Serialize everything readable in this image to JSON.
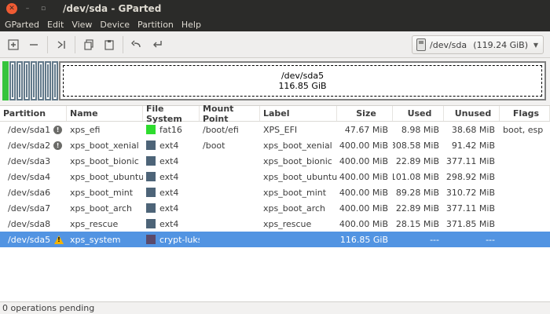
{
  "window": {
    "title": "/dev/sda - GParted",
    "close_glyph": "✕",
    "min_glyph": "–",
    "max_glyph": "▫"
  },
  "menu": [
    "GParted",
    "Edit",
    "View",
    "Device",
    "Partition",
    "Help"
  ],
  "toolbar": {
    "icons": [
      "new-icon",
      "delete-icon",
      "resize-move-icon",
      "copy-icon",
      "paste-icon",
      "undo-icon",
      "apply-icon"
    ],
    "device_label": "/dev/sda",
    "device_size": "(119.24 GiB)"
  },
  "map": {
    "big_name": "/dev/sda5",
    "big_size": "116.85 GiB",
    "colors": {
      "fat16": "#36c43c",
      "ext4": "#62798a",
      "luks": "#808080"
    }
  },
  "table": {
    "headers": [
      "Partition",
      "Name",
      "File System",
      "Mount Point",
      "Label",
      "Size",
      "Used",
      "Unused",
      "Flags"
    ],
    "rows": [
      {
        "partition": "/dev/sda1",
        "icon": "info",
        "name": "xps_efi",
        "fs": "fat16",
        "fs_color": "#2edc2e",
        "mount": "/boot/efi",
        "label": "XPS_EFI",
        "size": "47.67 MiB",
        "used": "8.98 MiB",
        "unused": "38.68 MiB",
        "flags": "boot, esp"
      },
      {
        "partition": "/dev/sda2",
        "icon": "info",
        "name": "xps_boot_xenial",
        "fs": "ext4",
        "fs_color": "#4d6478",
        "mount": "/boot",
        "label": "xps_boot_xenial",
        "size": "400.00 MiB",
        "used": "308.58 MiB",
        "unused": "91.42 MiB",
        "flags": ""
      },
      {
        "partition": "/dev/sda3",
        "icon": "",
        "name": "xps_boot_bionic",
        "fs": "ext4",
        "fs_color": "#4d6478",
        "mount": "",
        "label": "xps_boot_bionic",
        "size": "400.00 MiB",
        "used": "22.89 MiB",
        "unused": "377.11 MiB",
        "flags": ""
      },
      {
        "partition": "/dev/sda4",
        "icon": "",
        "name": "xps_boot_ubuntu",
        "fs": "ext4",
        "fs_color": "#4d6478",
        "mount": "",
        "label": "xps_boot_ubuntu",
        "size": "400.00 MiB",
        "used": "101.08 MiB",
        "unused": "298.92 MiB",
        "flags": ""
      },
      {
        "partition": "/dev/sda6",
        "icon": "",
        "name": "xps_boot_mint",
        "fs": "ext4",
        "fs_color": "#4d6478",
        "mount": "",
        "label": "xps_boot_mint",
        "size": "400.00 MiB",
        "used": "89.28 MiB",
        "unused": "310.72 MiB",
        "flags": ""
      },
      {
        "partition": "/dev/sda7",
        "icon": "",
        "name": "xps_boot_arch",
        "fs": "ext4",
        "fs_color": "#4d6478",
        "mount": "",
        "label": "xps_boot_arch",
        "size": "400.00 MiB",
        "used": "22.89 MiB",
        "unused": "377.11 MiB",
        "flags": ""
      },
      {
        "partition": "/dev/sda8",
        "icon": "",
        "name": "xps_rescue",
        "fs": "ext4",
        "fs_color": "#4d6478",
        "mount": "",
        "label": "xps_rescue",
        "size": "400.00 MiB",
        "used": "28.15 MiB",
        "unused": "371.85 MiB",
        "flags": ""
      },
      {
        "partition": "/dev/sda5",
        "icon": "warning",
        "name": "xps_system",
        "fs": "crypt-luks",
        "fs_color": "#5a4a6b",
        "mount": "",
        "label": "",
        "size": "116.85 GiB",
        "used": "---",
        "unused": "---",
        "flags": "",
        "selected": true
      }
    ]
  },
  "status": "0 operations pending"
}
